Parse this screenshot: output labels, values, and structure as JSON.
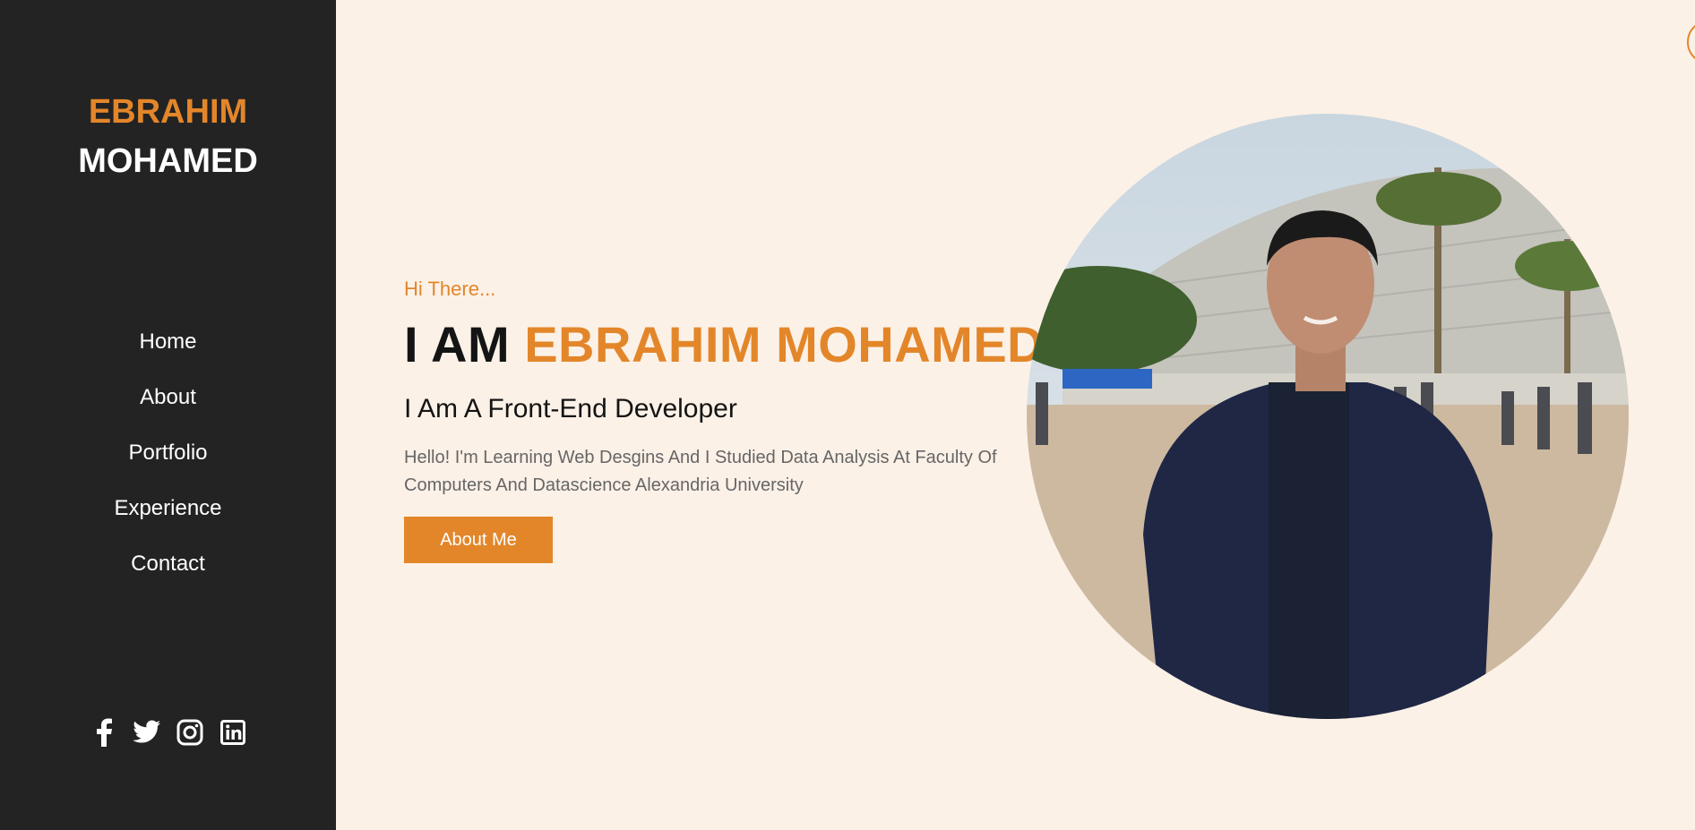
{
  "sidebar": {
    "brand": {
      "first": "EBRAHIM",
      "last": "MOHAMED"
    },
    "nav": [
      {
        "label": "Home"
      },
      {
        "label": "About"
      },
      {
        "label": "Portfolio"
      },
      {
        "label": "Experience"
      },
      {
        "label": "Contact"
      }
    ],
    "social": [
      {
        "icon": "facebook-icon"
      },
      {
        "icon": "twitter-icon"
      },
      {
        "icon": "instagram-icon"
      },
      {
        "icon": "linkedin-icon"
      }
    ]
  },
  "hero": {
    "greeting": "Hi There...",
    "headline_prefix": "I AM",
    "headline_name": "EBRAHIM MOHAMED",
    "role": "I Am A Front-End Developer",
    "bio": "Hello! I'm Learning Web Desgins And I Studied Data Analysis At Faculty Of Computers And Datascience Alexandria University",
    "cta_label": "About Me"
  },
  "colors": {
    "accent": "#e3862a",
    "sidebar_bg": "#232323",
    "page_bg": "#fcf1e7"
  }
}
